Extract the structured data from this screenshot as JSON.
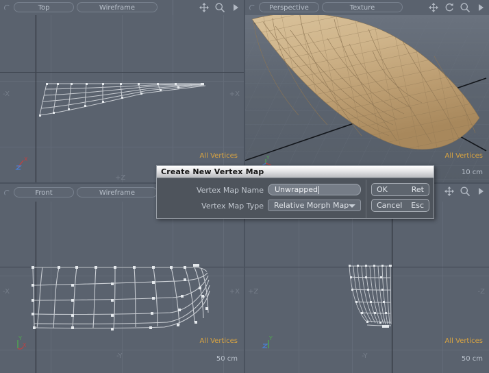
{
  "app": {
    "background_color": "#5a626e",
    "accent_color": "#d9a441"
  },
  "viewports": [
    {
      "id": "top-left",
      "view_label": "Top",
      "shading_label": "Wireframe",
      "selection_status": "All Vertices",
      "scale_label": "",
      "axis_left": "-X",
      "axis_right": "+X",
      "axis_bottom": "+Z",
      "gizmo_axes": [
        "X",
        "Z"
      ],
      "icons": [
        "move-icon",
        "zoom-icon",
        "expand-arrow-icon"
      ]
    },
    {
      "id": "top-right",
      "view_label": "Perspective",
      "shading_label": "Texture",
      "selection_status": "All Vertices",
      "scale_label": "10 cm",
      "axis_left": "",
      "axis_right": "",
      "axis_bottom": "",
      "gizmo_axes": [
        "Y",
        "X"
      ],
      "icons": [
        "move-icon",
        "rotate-icon",
        "zoom-icon",
        "expand-arrow-icon"
      ]
    },
    {
      "id": "bottom-left",
      "view_label": "Front",
      "shading_label": "Wireframe",
      "selection_status": "All Vertices",
      "scale_label": "50 cm",
      "axis_left": "-X",
      "axis_right": "+X",
      "axis_bottom": "-Y",
      "gizmo_axes": [
        "Y",
        "X"
      ],
      "icons": [
        "move-icon",
        "zoom-icon",
        "expand-arrow-icon"
      ]
    },
    {
      "id": "bottom-right",
      "view_label": "",
      "shading_label": "",
      "selection_status": "All Vertices",
      "scale_label": "50 cm",
      "axis_left": "+Z",
      "axis_right": "-Z",
      "axis_bottom": "-Y",
      "gizmo_axes": [
        "Y",
        "Z"
      ],
      "icons": [
        "move-icon",
        "zoom-icon",
        "expand-arrow-icon"
      ]
    }
  ],
  "dialog": {
    "title": "Create New Vertex Map",
    "fields": [
      {
        "label": "Vertex Map Name",
        "value": "Unwrapped",
        "type": "text"
      },
      {
        "label": "Vertex Map Type",
        "value": "Relative Morph Map",
        "type": "select"
      }
    ],
    "buttons": [
      {
        "label": "OK",
        "shortcut": "Ret"
      },
      {
        "label": "Cancel",
        "shortcut": "Esc"
      }
    ]
  }
}
